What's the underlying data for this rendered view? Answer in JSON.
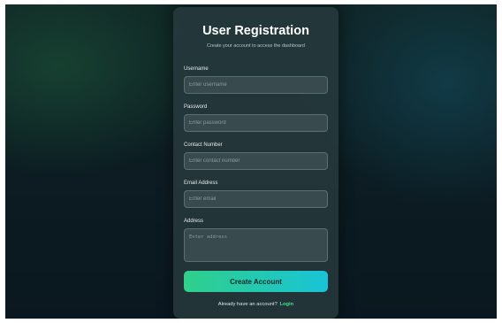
{
  "form": {
    "title": "User Registration",
    "subtitle": "Create your account to access the dashboard",
    "fields": [
      {
        "label": "Username",
        "placeholder": "Enter username",
        "value": ""
      },
      {
        "label": "Password",
        "placeholder": "Enter password",
        "value": ""
      },
      {
        "label": "Contact Number",
        "placeholder": "Enter contact number",
        "value": ""
      },
      {
        "label": "Email Address",
        "placeholder": "Enter email",
        "value": ""
      },
      {
        "label": "Address",
        "placeholder": "Enter address",
        "value": ""
      }
    ],
    "submit_label": "Create Account",
    "footer_text": "Already have an account?",
    "login_link": "Login"
  },
  "colors": {
    "accent_green": "#2fd08a",
    "accent_cyan": "#19c3d6",
    "link": "#3de08e"
  }
}
